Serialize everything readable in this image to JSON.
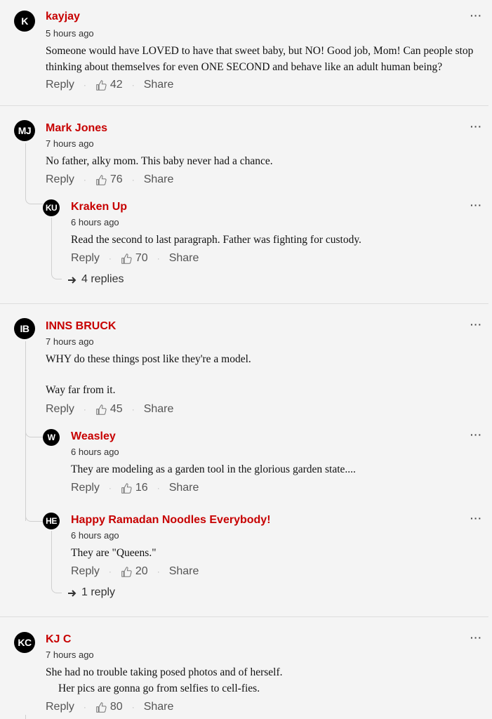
{
  "labels": {
    "reply": "Reply",
    "share": "Share",
    "more": "···",
    "sep": "·"
  },
  "comments": [
    {
      "initials": "K",
      "name": "kayjay",
      "time": "5 hours ago",
      "text": [
        "Someone would have LOVED to have that sweet baby, but NO! Good job, Mom! Can people stop thinking about themselves for even ONE SECOND and behave like an adult human being?"
      ],
      "likes": "42"
    },
    {
      "initials": "MJ",
      "name": "Mark Jones",
      "time": "7 hours ago",
      "text": [
        "No father, alky mom. This baby never had a chance."
      ],
      "likes": "76",
      "replies": [
        {
          "initials": "KU",
          "name": "Kraken Up",
          "time": "6 hours ago",
          "text": [
            "Read the second to last paragraph. Father was fighting for custody."
          ],
          "likes": "70"
        }
      ],
      "more_replies": "4 replies"
    },
    {
      "initials": "IB",
      "name": "INNS BRUCK",
      "time": "7 hours ago",
      "text": [
        "WHY do these things post like they're a model.",
        "Way far from it."
      ],
      "likes": "45",
      "replies": [
        {
          "initials": "W",
          "name": "Weasley",
          "time": "6 hours ago",
          "text": [
            "They are modeling as a garden tool in the glorious garden state...."
          ],
          "likes": "16"
        },
        {
          "initials": "HE",
          "name": "Happy Ramadan Noodles Everybody!",
          "time": "6 hours ago",
          "text": [
            "They are \"Queens.\""
          ],
          "likes": "20"
        }
      ],
      "more_replies": "1 reply"
    },
    {
      "initials": "KC",
      "name": "KJ C",
      "time": "7 hours ago",
      "text": [
        "She had no trouble taking posed photos and of herself.",
        "Her pics are gonna go from selfies to cell-fies."
      ],
      "likes": "80"
    }
  ]
}
